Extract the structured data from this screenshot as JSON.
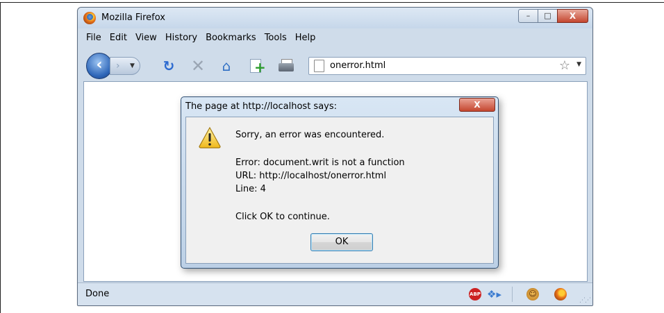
{
  "window": {
    "title": "Mozilla Firefox",
    "caption_buttons": {
      "minimize": "–",
      "maximize": "□",
      "close": "X"
    }
  },
  "menubar": {
    "items": [
      "File",
      "Edit",
      "View",
      "History",
      "Bookmarks",
      "Tools",
      "Help"
    ]
  },
  "navbar": {
    "back_icon": "‹",
    "forward_icon": "›",
    "url": "onerror.html"
  },
  "statusbar": {
    "text": "Done",
    "abp_label": "ABP"
  },
  "dialog": {
    "title": "The page at http://localhost says:",
    "close_label": "X",
    "lines": [
      "Sorry, an error was encountered.",
      "Error: document.writ is not a function",
      "URL: http://localhost/onerror.html",
      "Line: 4",
      "Click OK to continue."
    ],
    "ok_label": "OK"
  },
  "colors": {
    "chrome": "#cfdcea",
    "close_button": "#c4462f",
    "warning": "#f5c531"
  }
}
